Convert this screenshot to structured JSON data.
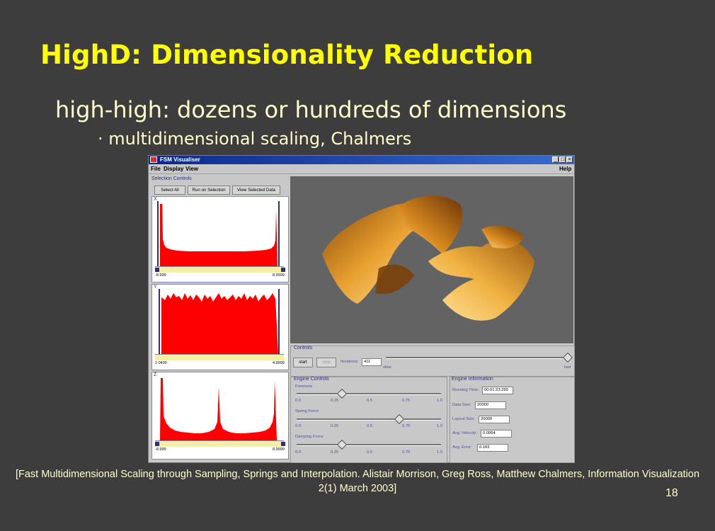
{
  "slide": {
    "title": "HighD: Dimensionality Reduction",
    "bullet1": "high-high: dozens or hundreds of dimensions",
    "bullet2": "· multidimensional scaling, Chalmers",
    "citation": "[Fast Multidimensional Scaling through Sampling, Springs and Interpolation. Alistair Morrison, Greg Ross, Matthew Chalmers, Information Visualization 2(1) March 2003]",
    "page_number": "18"
  },
  "window": {
    "title": "FSM Visualiser",
    "menu": [
      "File",
      "Display",
      "View"
    ],
    "help": "Help",
    "buttons": {
      "minimize": "_",
      "maximize": "□",
      "close": "×"
    }
  },
  "selection_controls": {
    "label": "Selection Controls",
    "buttons": [
      "Select All",
      "Run on Selection",
      "View Selected Data"
    ],
    "histograms": [
      {
        "label": "X",
        "min": "-8.999",
        "max": "8.9999"
      },
      {
        "label": "Y",
        "min": "2.0400",
        "max": "4.9999"
      },
      {
        "label": "Z",
        "min": "-8.999",
        "max": "8.9999"
      }
    ]
  },
  "controls": {
    "label": "Controls",
    "start": "start",
    "stop": "stop",
    "iterations_label": "Iterations:",
    "iterations_value": "411",
    "slow": "slow",
    "fast": "fast"
  },
  "engine_controls": {
    "label": "Engine Controls",
    "sliders": [
      {
        "name": "Freeness",
        "value": 0.3
      },
      {
        "name": "Spring Force",
        "value": 0.7
      },
      {
        "name": "Damping Force",
        "value": 0.3
      }
    ],
    "ticks": [
      "0.0",
      "0.25",
      "0.5",
      "0.75",
      "1.0"
    ]
  },
  "engine_information": {
    "label": "Engine Information",
    "rows": [
      {
        "label": "Running Time:",
        "value": "00:01:23:299"
      },
      {
        "label": "Data Size:",
        "value": "20000"
      },
      {
        "label": "Layout Size:",
        "value": "20000"
      },
      {
        "label": "Avg. Velocity:",
        "value": "0.0064"
      },
      {
        "label": "Avg. Error:",
        "value": "0.183"
      }
    ]
  },
  "colors": {
    "background": "#3d3d3d",
    "title": "#ffff00",
    "body_text": "#ffffcc",
    "histogram_fill": "#ff0000",
    "viz_background": "#636363"
  }
}
